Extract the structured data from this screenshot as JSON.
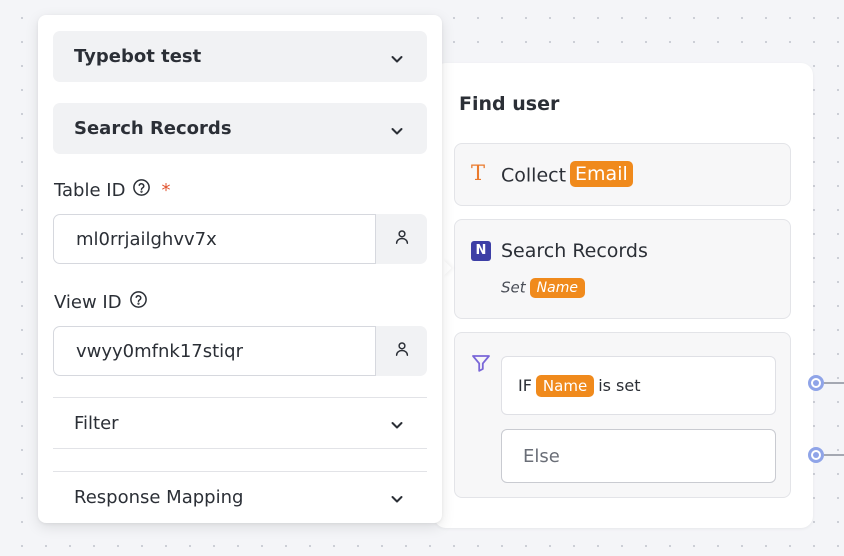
{
  "panel": {
    "credentials": "Typebot test",
    "action": "Search Records",
    "table_id": {
      "label": "Table ID",
      "required_mark": "*",
      "value": "ml0rrjailghvv7x"
    },
    "view_id": {
      "label": "View ID",
      "value": "vwyy0mfnk17stiqr"
    },
    "filter_label": "Filter",
    "response_mapping_label": "Response Mapping"
  },
  "group": {
    "title": "Find user",
    "collect": {
      "label": "Collect",
      "variable": "Email",
      "icon": "text-input-icon"
    },
    "search": {
      "label": "Search Records",
      "set_label": "Set",
      "variable": "Name",
      "icon": "nocodb-icon"
    },
    "condition": {
      "icon": "filter-icon",
      "if_label": "IF",
      "variable": "Name",
      "operator": "is set",
      "else_label": "Else"
    }
  },
  "colors": {
    "variable_tag": "#f08a1c",
    "collect_icon": "#ea7a2d",
    "nocodb_icon": "#3d3fa6",
    "port": "#8fa4e8",
    "required": "#e0532f",
    "canvas": "#f4f5f8"
  }
}
